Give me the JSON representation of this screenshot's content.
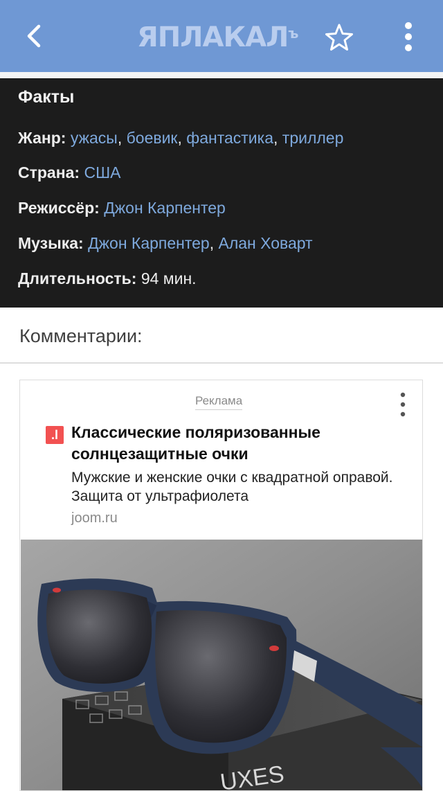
{
  "appbar": {
    "logo_text": "ЯПЛАКАЛ",
    "logo_suffix": "ъ",
    "icons": [
      "back-arrow-icon",
      "star-outline-icon",
      "more-vertical-icon"
    ],
    "bg_color": "#6f98d4"
  },
  "facts": {
    "heading": "Факты",
    "genre_label": "Жанр:",
    "genres": [
      "ужасы",
      "боевик",
      "фантастика",
      "триллер"
    ],
    "country_label": "Страна:",
    "country": "США",
    "director_label": "Режиссёр:",
    "director": "Джон Карпентер",
    "music_label": "Музыка:",
    "music": [
      "Джон Карпентер",
      "Алан Ховарт"
    ],
    "duration_label": "Длительность:",
    "duration": "94 мин.",
    "link_color": "#7ea9dd"
  },
  "comments": {
    "heading": "Комментарии:"
  },
  "ad": {
    "tag": "Реклама",
    "favicon_text": ".l",
    "title": "Классические поляризованные солнцезащитные очки",
    "description": "Мужские и женские очки с квадратной оправой. Защита от ультрафиолета",
    "domain": "joom.ru",
    "box_text": "UXES"
  }
}
